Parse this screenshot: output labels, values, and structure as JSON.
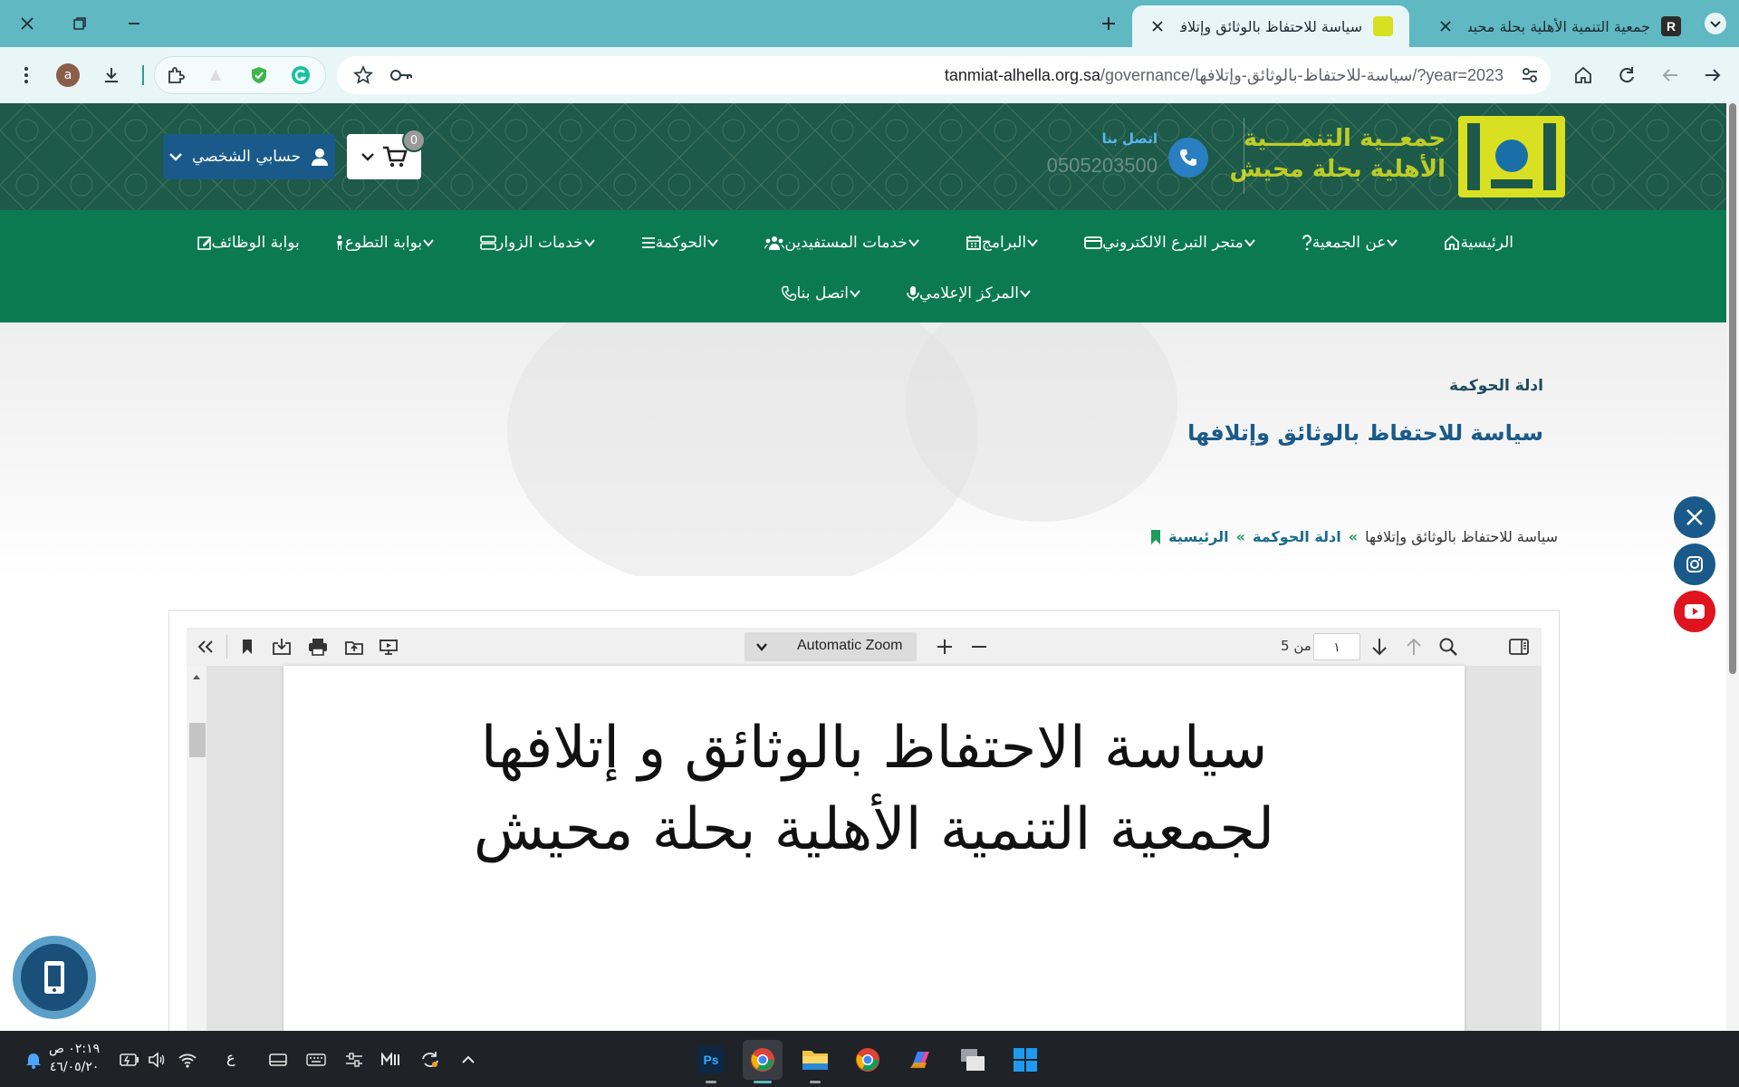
{
  "browser": {
    "tabs": [
      {
        "title": "جمعية التنمية الأهلية بحلة محيش",
        "active": false,
        "favicon": "r-logo-icon"
      },
      {
        "title": "سياسة للاحتفاظ بالوثائق وإتلافها",
        "active": true,
        "favicon": "site-logo-icon"
      }
    ],
    "address": {
      "host": "tanmiat-alhella.org.sa",
      "path": "/governance/سياسة-للاحتفاظ-بالوثائق-وإتلافها/?year=2023"
    },
    "profile_initial": "a"
  },
  "header": {
    "logo_line1": "جمعــية التنمــــية",
    "logo_line2": "الأهلية بحلة محيش",
    "contact_label": "اتصل بنا",
    "contact_phone": "0505203500",
    "cart_count": "0",
    "account_label": "حسابي الشخصي"
  },
  "nav": {
    "row1": [
      {
        "label": "الرئيسية",
        "icon": "home-icon",
        "dropdown": false
      },
      {
        "label": "عن الجمعية",
        "icon": "question-icon",
        "dropdown": true
      },
      {
        "label": "متجر التبرع الالكتروني",
        "icon": "card-icon",
        "dropdown": true
      },
      {
        "label": "البرامج",
        "icon": "calendar-icon",
        "dropdown": true
      },
      {
        "label": "خدمات المستفيدين",
        "icon": "users-icon",
        "dropdown": true
      },
      {
        "label": "الحوكمة",
        "icon": "list-icon",
        "dropdown": true
      },
      {
        "label": "خدمات الزوار",
        "icon": "server-icon",
        "dropdown": true
      },
      {
        "label": "بوابة التطوع",
        "icon": "person-icon",
        "dropdown": true
      },
      {
        "label": "بوابة الوظائف",
        "icon": "edit-icon",
        "dropdown": false
      }
    ],
    "row2": [
      {
        "label": "المركز الإعلامي",
        "icon": "mic-icon",
        "dropdown": true
      },
      {
        "label": "اتصل بنا",
        "icon": "phone-icon",
        "dropdown": true
      }
    ]
  },
  "hero": {
    "subtitle": "ادلة الحوكمة",
    "title": "سياسة للاحتفاظ بالوثائق وإتلافها"
  },
  "breadcrumb": {
    "home": "الرئيسية",
    "section": "ادلة الحوكمة",
    "current": "سياسة للاحتفاظ بالوثائق وإتلافها",
    "separator": "»"
  },
  "pdf_viewer": {
    "zoom_label": "Automatic Zoom",
    "page_number": "١",
    "page_of": "من 5",
    "document_line1": "سياسة الاحتفاظ بالوثائق و إتلافها",
    "document_line2": "لجمعية التنمية الأهلية بحلة محيش"
  },
  "taskbar": {
    "time": "٠٢:١٩ ص",
    "date": "٤٦/٠٥/٢٠",
    "language": "ع"
  },
  "colors": {
    "tabstrip": "#5fb8c2",
    "header_bg": "#1e5a49",
    "nav_bg": "#0b7a53",
    "accent_blue": "#1a5a8a",
    "logo_yellow": "#d9e021"
  }
}
